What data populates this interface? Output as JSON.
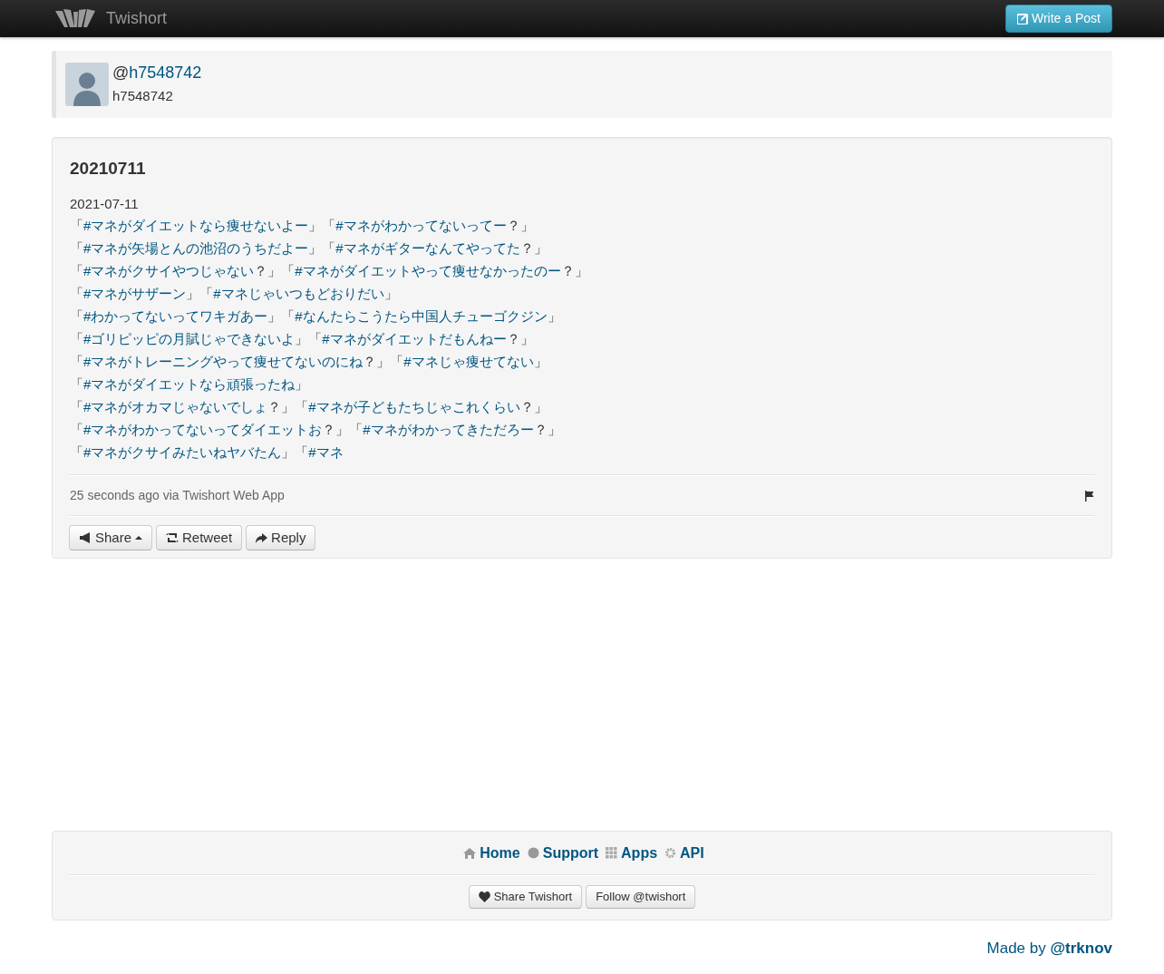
{
  "navbar": {
    "brand": "Twishort",
    "write_button": "Write a Post"
  },
  "author": {
    "handle_prefix": "@",
    "handle": "h7548742",
    "name": "h7548742"
  },
  "post": {
    "title": "20210711",
    "date": "2021-07-11",
    "lines": [
      [
        {
          "kind": "plain",
          "text": "「"
        },
        {
          "kind": "tag",
          "text": "#マネがダイエットなら痩せないよー"
        },
        {
          "kind": "plain",
          "text": "」「"
        },
        {
          "kind": "tag",
          "text": "#マネがわかってないってー"
        },
        {
          "kind": "plain",
          "text": "？」"
        }
      ],
      [
        {
          "kind": "plain",
          "text": "「"
        },
        {
          "kind": "tag",
          "text": "#マネが矢場とんの池沼のうちだよー"
        },
        {
          "kind": "plain",
          "text": "」「"
        },
        {
          "kind": "tag",
          "text": "#マネがギターなんてやってた"
        },
        {
          "kind": "plain",
          "text": "？」"
        }
      ],
      [
        {
          "kind": "plain",
          "text": "「"
        },
        {
          "kind": "tag",
          "text": "#マネがクサイやつじゃない"
        },
        {
          "kind": "plain",
          "text": "？」「"
        },
        {
          "kind": "tag",
          "text": "#マネがダイエットやって痩せなかったのー"
        },
        {
          "kind": "plain",
          "text": "？」"
        }
      ],
      [
        {
          "kind": "plain",
          "text": "「"
        },
        {
          "kind": "tag",
          "text": "#マネがサザーン"
        },
        {
          "kind": "plain",
          "text": "」「"
        },
        {
          "kind": "tag",
          "text": "#マネじゃいつもどおりだい"
        },
        {
          "kind": "plain",
          "text": "」"
        }
      ],
      [
        {
          "kind": "plain",
          "text": "「"
        },
        {
          "kind": "tag",
          "text": "#わかってないってワキガあー"
        },
        {
          "kind": "plain",
          "text": "」「"
        },
        {
          "kind": "tag",
          "text": "#なんたらこうたら中国人チューゴクジン"
        },
        {
          "kind": "plain",
          "text": "」"
        }
      ],
      [
        {
          "kind": "plain",
          "text": "「"
        },
        {
          "kind": "tag",
          "text": "#ゴリピッピの月賦じゃできないよ"
        },
        {
          "kind": "plain",
          "text": "」「"
        },
        {
          "kind": "tag",
          "text": "#マネがダイエットだもんねー"
        },
        {
          "kind": "plain",
          "text": "？」"
        }
      ],
      [
        {
          "kind": "plain",
          "text": "「"
        },
        {
          "kind": "tag",
          "text": "#マネがトレーニングやって痩せてないのにね"
        },
        {
          "kind": "plain",
          "text": "？」「"
        },
        {
          "kind": "tag",
          "text": "#マネじゃ痩せてない"
        },
        {
          "kind": "plain",
          "text": "」"
        }
      ],
      [
        {
          "kind": "plain",
          "text": "「"
        },
        {
          "kind": "tag",
          "text": "#マネがダイエットなら頑張ったね"
        },
        {
          "kind": "plain",
          "text": "」"
        }
      ],
      [
        {
          "kind": "plain",
          "text": "「"
        },
        {
          "kind": "tag",
          "text": "#マネがオカマじゃないでしょ"
        },
        {
          "kind": "plain",
          "text": "？」「"
        },
        {
          "kind": "tag",
          "text": "#マネが子どもたちじゃこれくらい"
        },
        {
          "kind": "plain",
          "text": "？」"
        }
      ],
      [
        {
          "kind": "plain",
          "text": "「"
        },
        {
          "kind": "tag",
          "text": "#マネがわかってないってダイエットお"
        },
        {
          "kind": "plain",
          "text": "？」「"
        },
        {
          "kind": "tag",
          "text": "#マネがわかってきただろー"
        },
        {
          "kind": "plain",
          "text": "？」"
        }
      ],
      [
        {
          "kind": "plain",
          "text": "「"
        },
        {
          "kind": "tag",
          "text": "#マネがクサイみたいねヤバたん"
        },
        {
          "kind": "plain",
          "text": "」「"
        },
        {
          "kind": "tag",
          "text": "#マネ"
        }
      ]
    ],
    "meta": "25 seconds ago via Twishort Web App",
    "actions": [
      {
        "kind": "share",
        "label": "Share"
      },
      {
        "kind": "retweet",
        "label": "Retweet"
      },
      {
        "kind": "reply",
        "label": "Reply"
      }
    ]
  },
  "footer": {
    "links": [
      {
        "kind": "home",
        "label": "Home"
      },
      {
        "kind": "support",
        "label": "Support"
      },
      {
        "kind": "apps",
        "label": "Apps"
      },
      {
        "kind": "api",
        "label": "API"
      }
    ],
    "buttons": [
      {
        "kind": "heart",
        "label": "Share Twishort"
      },
      {
        "kind": "plain",
        "label": "Follow @twishort"
      }
    ],
    "made_by": "Made by ",
    "made_by_link": "@trknov"
  }
}
